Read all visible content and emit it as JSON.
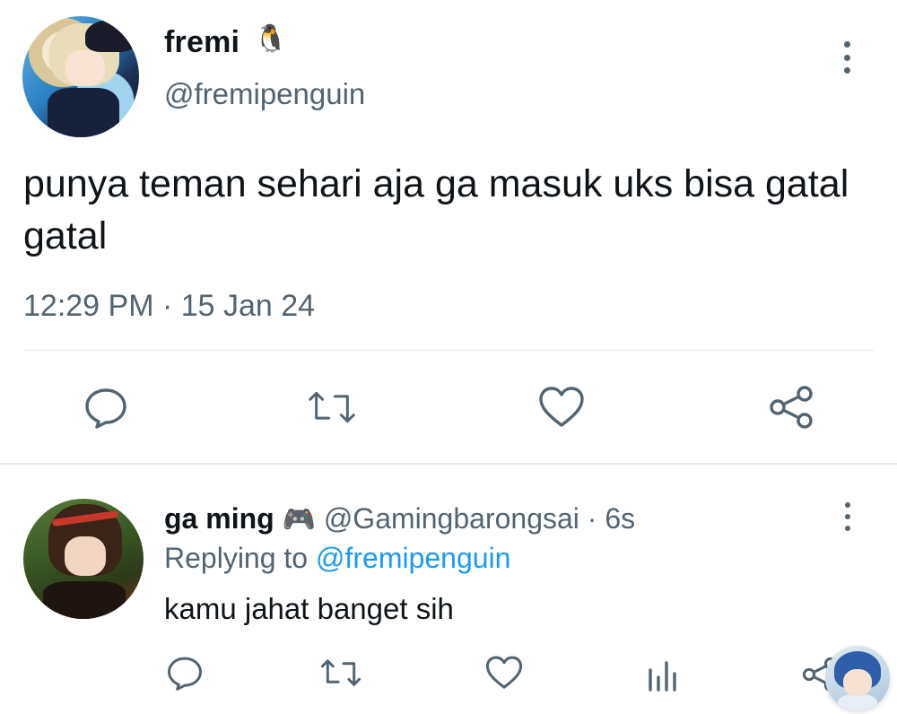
{
  "main_tweet": {
    "display_name": "fremi",
    "name_emoji": "🐧",
    "handle": "@fremipenguin",
    "text": "punya teman sehari aja ga masuk uks bisa gatal gatal",
    "timestamp": "12:29 PM · 15 Jan 24",
    "actions": [
      "reply-icon",
      "retweet-icon",
      "like-icon",
      "share-icon"
    ]
  },
  "reply_tweet": {
    "display_name": "ga ming",
    "name_emoji": "🎮",
    "handle": "@Gamingbarongsai",
    "separator": "·",
    "time_ago": "6s",
    "replying_prefix": "Replying to",
    "replying_mention": "@fremipenguin",
    "text": "kamu jahat banget sih",
    "actions": [
      "reply-icon",
      "retweet-icon",
      "like-icon",
      "views-icon",
      "share-icon"
    ]
  },
  "colors": {
    "text_primary": "#0f1419",
    "text_secondary": "#536471",
    "accent": "#1d9bf0",
    "divider": "#e1e8ed"
  }
}
